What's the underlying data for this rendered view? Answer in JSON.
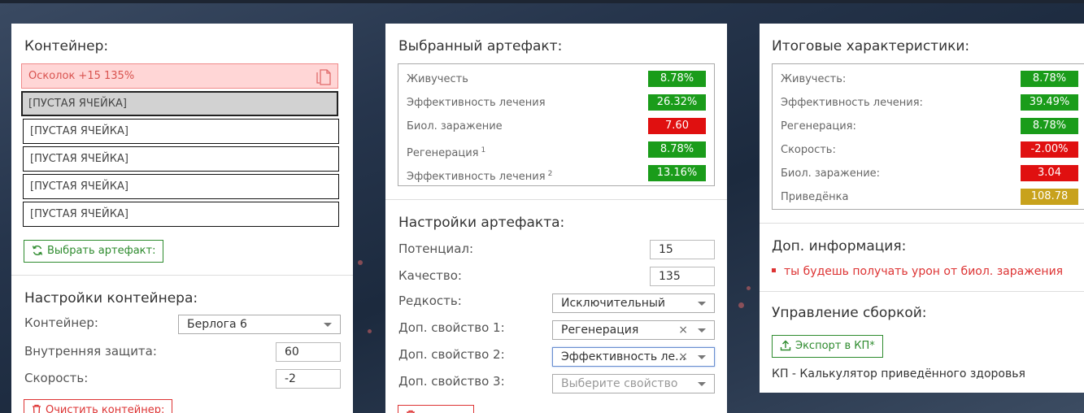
{
  "container_panel": {
    "title": "Контейнер:",
    "slots": [
      {
        "text": "Осколок +15 135%"
      },
      {
        "text": "[ПУСТАЯ ЯЧЕЙКА]"
      },
      {
        "text": "[ПУСТАЯ ЯЧЕЙКА]"
      },
      {
        "text": "[ПУСТАЯ ЯЧЕЙКА]"
      },
      {
        "text": "[ПУСТАЯ ЯЧЕЙКА]"
      },
      {
        "text": "[ПУСТАЯ ЯЧЕЙКА]"
      }
    ],
    "choose_button": "Выбрать артефакт:",
    "settings_title": "Настройки контейнера:",
    "container_label": "Контейнер:",
    "container_value": "Берлога 6",
    "inner_protection_label": "Внутренняя защита:",
    "inner_protection_value": "60",
    "speed_label": "Скорость:",
    "speed_value": "-2",
    "clear_button": "Очистить контейнер:"
  },
  "artifact_panel": {
    "title": "Выбранный артефакт:",
    "stats": [
      {
        "label": "Живучесть",
        "sup": "",
        "value": "8.78%",
        "color": "#1a9c1a"
      },
      {
        "label": "Эффективность лечения",
        "sup": "",
        "value": "26.32%",
        "color": "#1a9c1a"
      },
      {
        "label": "Биол. заражение",
        "sup": "",
        "value": "7.60",
        "color": "#e01010"
      },
      {
        "label": "Регенерация",
        "sup": "1",
        "value": "8.78%",
        "color": "#1a9c1a"
      },
      {
        "label": "Эффективность лечения",
        "sup": "2",
        "value": "13.16%",
        "color": "#1a9c1a"
      }
    ],
    "settings_title": "Настройки артефакта:",
    "potential_label": "Потенциал:",
    "potential_value": "15",
    "quality_label": "Качество:",
    "quality_value": "135",
    "rarity_label": "Редкость:",
    "rarity_value": "Исключительный",
    "prop1_label": "Доп. свойство 1:",
    "prop1_value": "Регенерация",
    "prop2_label": "Доп. свойство 2:",
    "prop2_value": "Эффективность ле...",
    "prop3_label": "Доп. свойство 3:",
    "prop3_placeholder": "Выберите свойство",
    "clear_glyph": "×"
  },
  "totals_panel": {
    "title": "Итоговые характеристики:",
    "stats": [
      {
        "label": "Живучесть:",
        "value": "8.78%",
        "color": "#1a9c1a"
      },
      {
        "label": "Эффективность лечения:",
        "value": "39.49%",
        "color": "#1a9c1a"
      },
      {
        "label": "Регенерация:",
        "value": "8.78%",
        "color": "#1a9c1a"
      },
      {
        "label": "Скорость:",
        "value": "-2.00%",
        "color": "#e01010"
      },
      {
        "label": "Биол. заражение:",
        "value": "3.04",
        "color": "#e01010"
      },
      {
        "label": "Приведёнка",
        "value": "108.78",
        "color": "#c8a21c"
      }
    ],
    "info_title": "Доп. информация:",
    "info_items": [
      "ты будешь получать урон от биол. заражения"
    ],
    "build_title": "Управление сборкой:",
    "export_button": "Экспорт в КП*",
    "footnote": "КП - Калькулятор приведённого здоровья"
  },
  "icons": [
    "document-copy-icon",
    "refresh-icon",
    "trash-icon",
    "upload-icon",
    "chevron-down-icon",
    "close-icon"
  ]
}
